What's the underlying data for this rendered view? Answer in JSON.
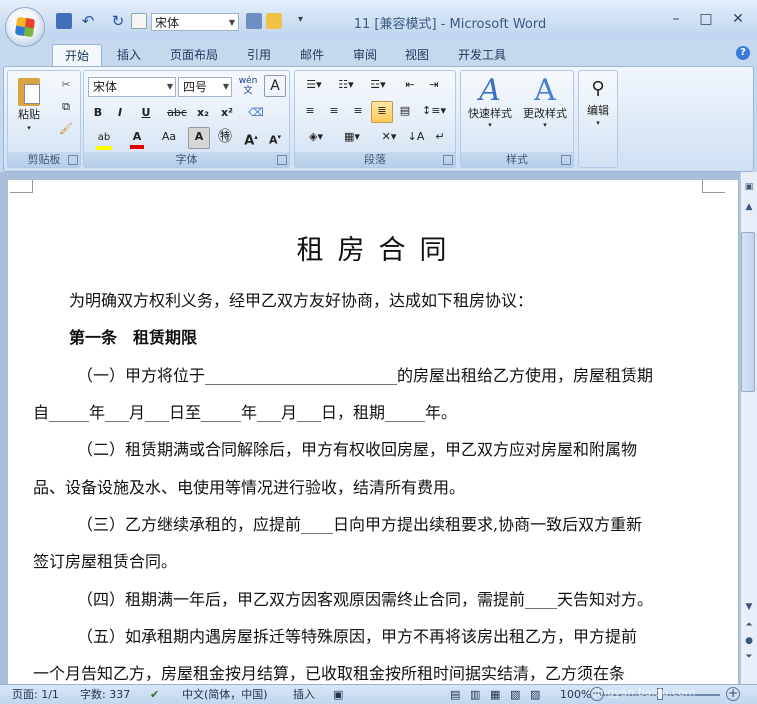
{
  "window": {
    "title": "11 [兼容模式] - Microsoft Word",
    "qat_font": "宋体",
    "min": "–",
    "max": "□",
    "close": "✕"
  },
  "tabs": [
    "开始",
    "插入",
    "页面布局",
    "引用",
    "邮件",
    "审阅",
    "视图",
    "开发工具"
  ],
  "ribbon": {
    "clipboard": {
      "label": "剪贴板",
      "paste": "粘贴"
    },
    "font": {
      "label": "字体",
      "font_name": "宋体",
      "font_size": "四号",
      "wen": "wén\n文",
      "bold": "B",
      "italic": "I",
      "underline": "U",
      "strike": "abc",
      "sub": "x₂",
      "sup": "x²",
      "grow": "A",
      "aa": "Aa"
    },
    "paragraph": {
      "label": "段落"
    },
    "styles": {
      "label": "样式",
      "quick": "快速样式",
      "change": "更改样式"
    },
    "editing": {
      "label": "编辑"
    }
  },
  "document": {
    "title": "租房合同",
    "lines": [
      "为明确双方权利义务，经甲乙双方友好协商，达成如下租房协议：",
      "第一条　租赁期限",
      "（一）甲方将位于________________________的房屋出租给乙方使用，房屋租赁期",
      "自_____年___月___日至_____年___月___日，租期_____年。",
      "（二）租赁期满或合同解除后，甲方有权收回房屋，甲乙双方应对房屋和附属物",
      "品、设备设施及水、电使用等情况进行验收，结清所有费用。",
      "（三）乙方继续承租的，应提前____日向甲方提出续租要求,协商一致后双方重新",
      "签订房屋租赁合同。",
      "（四）租期满一年后，甲乙双方因客观原因需终止合同，需提前____天告知对方。",
      "（五）如承租期内遇房屋拆迁等特殊原因，甲方不再将该房出租乙方，甲方提前",
      "一个月告知乙方，房屋租金按月结算，已收取租金按所租时间据实结清，乙方须在条"
    ]
  },
  "status": {
    "page": "页面: 1/1",
    "words": "字数: 337",
    "lang": "中文(简体，中国)",
    "insert": "插入",
    "zoom": "100%",
    "watermark": "jingyan.baidu.com"
  }
}
